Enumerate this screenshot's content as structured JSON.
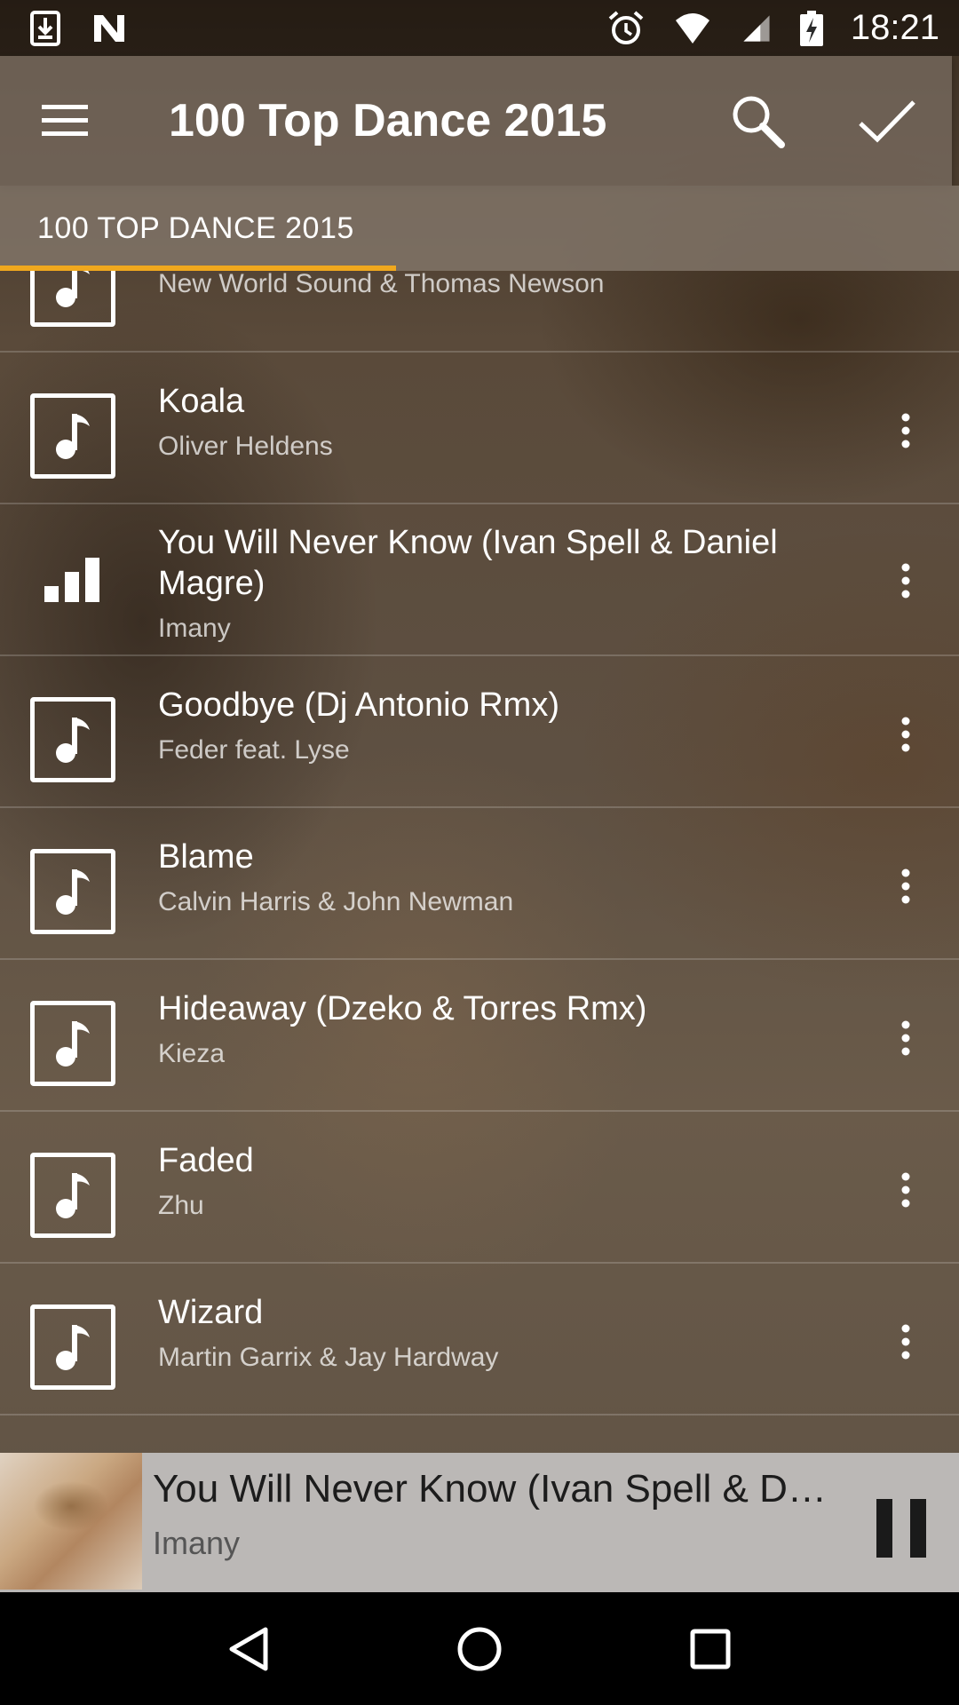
{
  "status_bar": {
    "time": "18:21",
    "icons": [
      "download-icon",
      "n-notification-icon",
      "alarm-icon",
      "wifi-icon",
      "signal-icon",
      "battery-charging-icon"
    ]
  },
  "toolbar": {
    "title": "100 Top Dance 2015",
    "menu_icon": "hamburger-menu-icon",
    "search_icon": "search-icon",
    "confirm_icon": "check-icon"
  },
  "tabs": [
    {
      "label": "100 TOP DANCE 2015",
      "selected": true
    }
  ],
  "colors": {
    "tab_indicator": "#f0a81e",
    "mini_player_bg": "#bbb8b6"
  },
  "tracks": [
    {
      "title": "",
      "artist": "New World Sound & Thomas Newson",
      "state": "default"
    },
    {
      "title": "Koala",
      "artist": "Oliver Heldens",
      "state": "default"
    },
    {
      "title": "You Will Never Know (Ivan Spell & Daniel Magre)",
      "artist": "Imany",
      "state": "playing"
    },
    {
      "title": "Goodbye (Dj Antonio Rmx)",
      "artist": "Feder feat. Lyse",
      "state": "default"
    },
    {
      "title": "Blame",
      "artist": "Calvin Harris & John Newman",
      "state": "default"
    },
    {
      "title": "Hideaway (Dzeko & Torres Rmx)",
      "artist": "Kieza",
      "state": "default"
    },
    {
      "title": "Faded",
      "artist": "Zhu",
      "state": "default"
    },
    {
      "title": "Wizard",
      "artist": "Martin Garrix & Jay Hardway",
      "state": "default"
    }
  ],
  "mini_player": {
    "title": "You Will Never Know (Ivan Spell & Dan…",
    "artist": "Imany",
    "control_icon": "pause-icon"
  },
  "nav_bar": {
    "icons": [
      "back-icon",
      "home-icon",
      "recents-icon"
    ]
  }
}
